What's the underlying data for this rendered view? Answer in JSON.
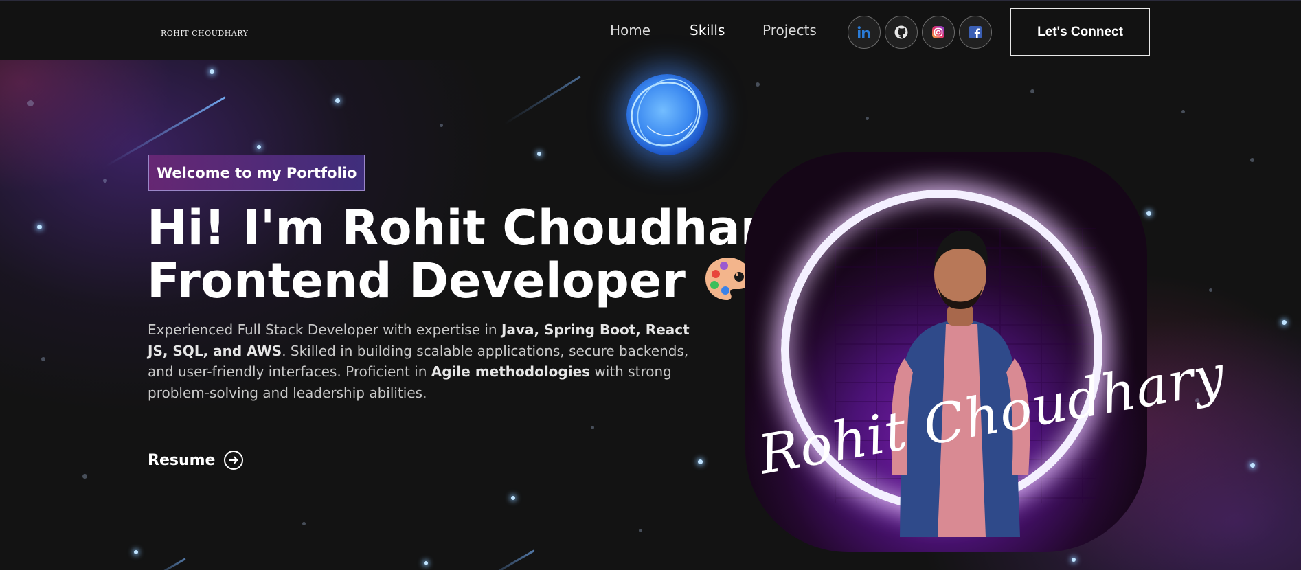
{
  "nav": {
    "logo": "ROHIT CHOUDHARY",
    "links": [
      "Home",
      "Skills",
      "Projects"
    ],
    "active": "Skills",
    "socials": [
      "linkedin-icon",
      "github-icon",
      "instagram-icon",
      "facebook-icon"
    ],
    "connect_label": "Let's Connect"
  },
  "hero": {
    "badge": "Welcome to my Portfolio",
    "headline_line1": "Hi! I'm Rohit Choudhary",
    "headline_line2": "Frontend Developer",
    "intro": {
      "t1": "Experienced Full Stack Developer with expertise in ",
      "b1": "Java, Spring Boot, React JS, SQL, and AWS",
      "t2": ". Skilled in building scalable applications, secure backends, and user-friendly interfaces. Proficient in ",
      "b2": "Agile methodologies",
      "t3": " with strong problem-solving and leadership abilities."
    },
    "resume_label": "Resume"
  },
  "portrait": {
    "signature": "Rohit Choudhary"
  },
  "colors": {
    "background": "#121212",
    "badge_gradient_start": "#6e2878",
    "badge_gradient_end": "#46328c",
    "orb": "#3a88f0",
    "ring": "#f4f0ff"
  }
}
